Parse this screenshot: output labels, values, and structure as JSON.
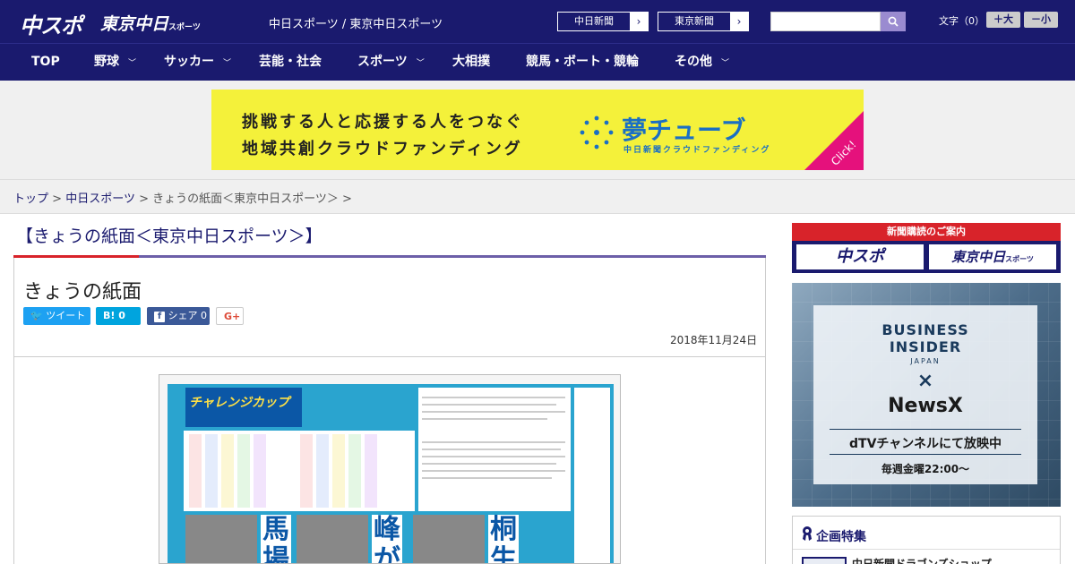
{
  "header": {
    "logo_chuspo": "中スポ",
    "logo_tokyo": "東京中日",
    "logo_tokyo_suffix": "スポーツ",
    "site_names": "中日スポーツ / 東京中日スポーツ",
    "btn_chunichi": "中日新聞",
    "btn_tokyo": "東京新聞",
    "btn_arrow": "›",
    "search_placeholder": "",
    "search_icon": "search-icon",
    "font_size_label": "文字（0）",
    "font_plus": "＋大",
    "font_minus": "－小"
  },
  "nav": {
    "items": [
      {
        "label": "TOP"
      },
      {
        "label": "野球"
      },
      {
        "label": "サッカー"
      },
      {
        "label": "芸能・社会"
      },
      {
        "label": "スポーツ"
      },
      {
        "label": "大相撲"
      },
      {
        "label": "競馬・ボート・競輪"
      },
      {
        "label": "その他"
      }
    ],
    "chevron": "﹀"
  },
  "banner": {
    "line1": "挑戦する人と応援する人をつなぐ",
    "line2": "地域共創クラウドファンディング",
    "logo": "夢チューブ",
    "sub": "中日新聞クラウドファンディング",
    "click": "Click!"
  },
  "breadcrumb": {
    "top": "トップ",
    "sep": ">",
    "chunichi": "中日スポーツ",
    "current": "きょうの紙面＜東京中日スポーツ＞"
  },
  "article": {
    "heading": "【きょうの紙面＜東京中日スポーツ＞】",
    "title": "きょうの紙面",
    "tweet": "ツイート",
    "hatena": "B! 0",
    "facebook": "シェア 0",
    "gplus": "G+",
    "date": "2018年11月24日"
  },
  "paper": {
    "headline": "チャレンジカップ",
    "name1": "馬場",
    "name2": "峰が",
    "name3": "桐生"
  },
  "sidebar": {
    "subscribe_title": "新聞購読のご案内",
    "sub_left": "中スポ",
    "sub_right": "東京中日",
    "sub_right_suffix": "スポーツ",
    "ad_title1": "BUSINESS",
    "ad_title2": "INSIDER",
    "ad_sub": "JAPAN",
    "ad_x": "×",
    "ad_newsx": "NewsX",
    "ad_dtv": "dTVチャンネルにて放映中",
    "ad_weekly": "毎週金曜22:00〜",
    "feature_title": "企画特集",
    "feature_item": "中日新聞ドラゴンズショップ"
  },
  "colors": {
    "header_bg": "#1a1a6e",
    "accent_red": "#d8232a",
    "accent_purple": "#6c5fa8",
    "banner_yellow": "#f4f13a",
    "banner_blue": "#1a6fc4"
  }
}
